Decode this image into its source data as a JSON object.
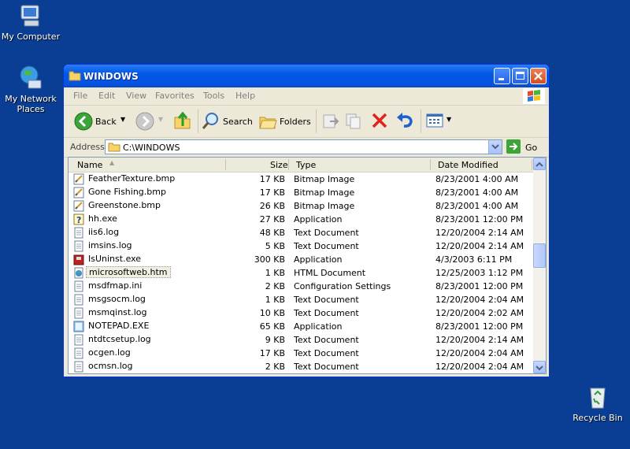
{
  "desktop": {
    "icons": [
      {
        "label": "My Computer"
      },
      {
        "label": "My Network Places"
      },
      {
        "label": "Recycle Bin"
      }
    ]
  },
  "window": {
    "title": "WINDOWS",
    "menu": [
      "File",
      "Edit",
      "View",
      "Favorites",
      "Tools",
      "Help"
    ],
    "toolbar": {
      "back_label": "Back",
      "search_label": "Search",
      "folders_label": "Folders"
    },
    "address": {
      "label": "Address",
      "value": "C:\\WINDOWS",
      "go_label": "Go"
    },
    "columns": {
      "name": "Name",
      "size": "Size",
      "type": "Type",
      "date": "Date Modified"
    },
    "files": [
      {
        "name": "FeatherTexture.bmp",
        "size": "17 KB",
        "type": "Bitmap Image",
        "date": "8/23/2001 4:00 AM",
        "icon": "bitmap-icon"
      },
      {
        "name": "Gone Fishing.bmp",
        "size": "17 KB",
        "type": "Bitmap Image",
        "date": "8/23/2001 4:00 AM",
        "icon": "bitmap-icon"
      },
      {
        "name": "Greenstone.bmp",
        "size": "26 KB",
        "type": "Bitmap Image",
        "date": "8/23/2001 4:00 AM",
        "icon": "bitmap-icon"
      },
      {
        "name": "hh.exe",
        "size": "27 KB",
        "type": "Application",
        "date": "8/23/2001 12:00 PM",
        "icon": "help-exe-icon"
      },
      {
        "name": "iis6.log",
        "size": "48 KB",
        "type": "Text Document",
        "date": "12/20/2004 2:14 AM",
        "icon": "text-document-icon"
      },
      {
        "name": "imsins.log",
        "size": "5 KB",
        "type": "Text Document",
        "date": "12/20/2004 2:14 AM",
        "icon": "text-document-icon"
      },
      {
        "name": "IsUninst.exe",
        "size": "300 KB",
        "type": "Application",
        "date": "4/3/2003 6:11 PM",
        "icon": "installer-exe-icon"
      },
      {
        "name": "microsoftweb.htm",
        "size": "1 KB",
        "type": "HTML Document",
        "date": "12/25/2003 1:12 PM",
        "icon": "html-document-icon"
      },
      {
        "name": "msdfmap.ini",
        "size": "2 KB",
        "type": "Configuration Settings",
        "date": "8/23/2001 12:00 PM",
        "icon": "text-document-icon"
      },
      {
        "name": "msgsocm.log",
        "size": "1 KB",
        "type": "Text Document",
        "date": "12/20/2004 2:04 AM",
        "icon": "text-document-icon"
      },
      {
        "name": "msmqinst.log",
        "size": "10 KB",
        "type": "Text Document",
        "date": "12/20/2004 2:02 AM",
        "icon": "text-document-icon"
      },
      {
        "name": "NOTEPAD.EXE",
        "size": "65 KB",
        "type": "Application",
        "date": "8/23/2001 12:00 PM",
        "icon": "notepad-icon"
      },
      {
        "name": "ntdtcsetup.log",
        "size": "9 KB",
        "type": "Text Document",
        "date": "12/20/2004 2:14 AM",
        "icon": "text-document-icon"
      },
      {
        "name": "ocgen.log",
        "size": "17 KB",
        "type": "Text Document",
        "date": "12/20/2004 2:04 AM",
        "icon": "text-document-icon"
      },
      {
        "name": "ocmsn.log",
        "size": "2 KB",
        "type": "Text Document",
        "date": "12/20/2004 2:04 AM",
        "icon": "text-document-icon"
      }
    ],
    "selected_index": 7
  },
  "colors": {
    "desktop": "#0a3e95",
    "titlebar": "#0058e6",
    "window_bg": "#ece9d8"
  }
}
